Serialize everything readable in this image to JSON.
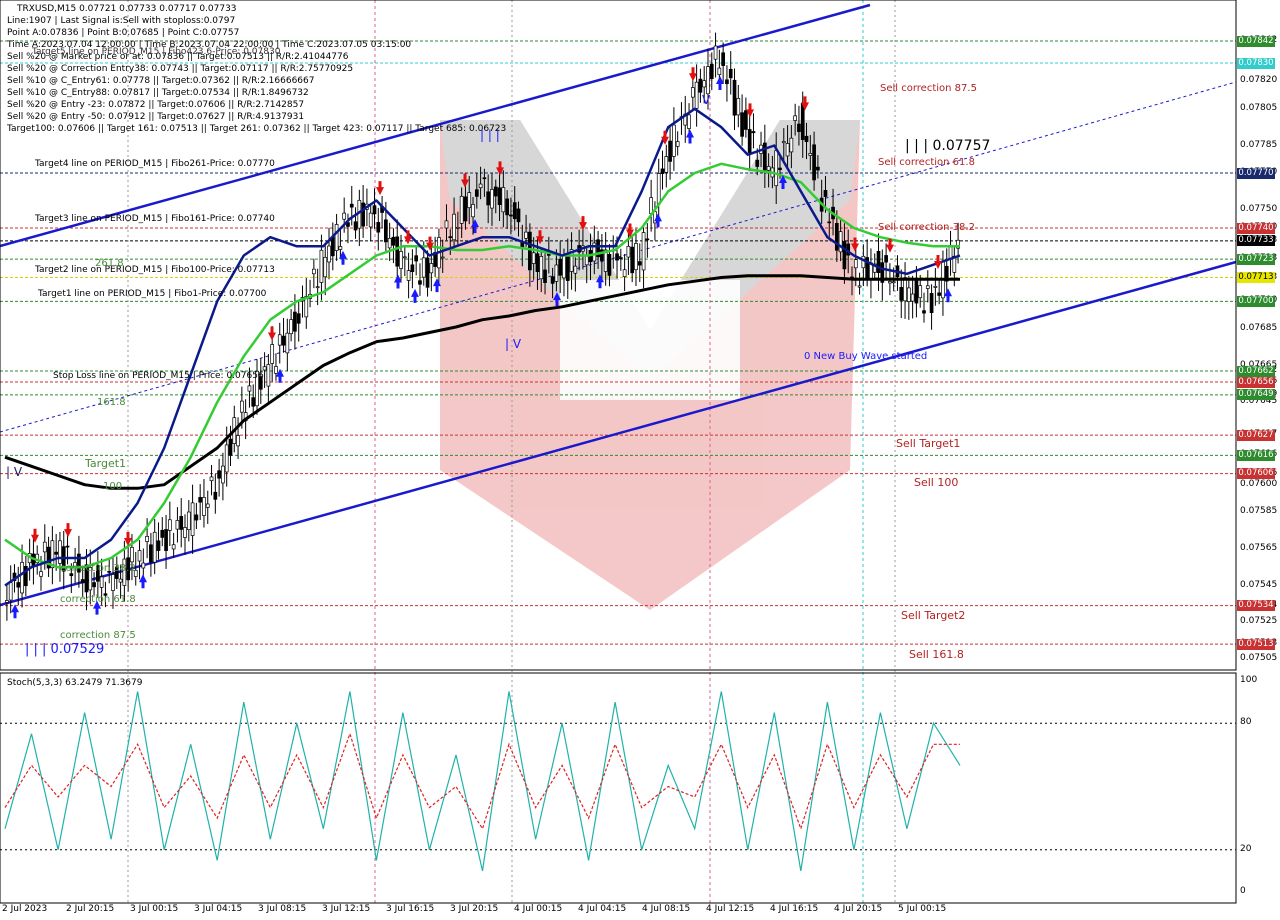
{
  "header": {
    "symbol_line": "TRXUSD,M15  0.07721 0.07733 0.07717 0.07733",
    "lines": [
      "Line:1907 | Last Signal is:Sell with stoploss:0.0797",
      "Point A:0.07836 | Point B:0.07685 | Point C:0.07757",
      "Time A:2023.07.04 12:00:00 | Time B:2023.07.04 22:00:00 | Time C:2023.07.05 03:15:00",
      "Sell %20 @ Market price or at: 0.07836 || Target:0.07513 || R/R:2.41044776",
      "Sell %20 @ Correction Entry38: 0.07743 || Target:0.07117 || R/R:2.75770925",
      "Sell %10 @ C_Entry61: 0.07778 || Target:0.07362 || R/R:2.16666667",
      "Sell %10 @ C_Entry88: 0.07817 || Target:0.07534 || R/R:1.8496732",
      "Sell %20 @ Entry -23: 0.07872 || Target:0.07606 || R/R:2.7142857",
      "Sell %20 @ Entry -50: 0.07912 || Target:0.07627 || R/R:4.9137931",
      "Target100: 0.07606 || Target 161: 0.07513 || Target 261: 0.07362 || Target 423: 0.07117 || Target 685: 0.06723"
    ],
    "overlay_line": "Target5 line on PERIOD_M15 | Fibo423.6-Price: 0.07830"
  },
  "chart_labels": {
    "target4": "Target4 line on PERIOD_M15 | Fibo261-Price: 0.07770",
    "target3": "Target3 line on PERIOD_M15 | Fibo161-Price: 0.07740",
    "target2": "Target2 line on PERIOD_M15 | Fibo100-Price: 0.07713",
    "target1_overlap": "Target1 line on PERIOD_M15 | Fibo1-Price: 0.07700",
    "stoploss": "Stop Loss line on PERIOD_M15 | Price: 0.07656",
    "fib_2618": "261.8",
    "fib_1618": "161.8",
    "target1_green": "Target1",
    "fib_100": "100",
    "corr_382": "correction 38.2",
    "corr_618": "correction 61.8",
    "corr_875": "correction 87.5",
    "wave_low": "| | | 0.07529",
    "wave_iv_left": "| V",
    "wave_iv_mid": "| V",
    "wave_iii": "| | |",
    "wave_v": "V",
    "wave_c": "| | | 0.07757",
    "sell_corr_875": "Sell correction 87.5",
    "sell_corr_618": "Sell correction 61.8",
    "sell_corr_382": "Sell correction 38.2",
    "buy_wave": "0 New Buy Wave started",
    "sell_target1": "Sell Target1",
    "sell_100": "Sell 100",
    "sell_target2": "Sell Target2",
    "sell_1618": "Sell 161.8"
  },
  "price_axis": {
    "ticks": [
      "0.07842",
      "0.07820",
      "0.07805",
      "0.07785",
      "0.07770",
      "0.07750",
      "0.07740",
      "0.07733",
      "0.07723",
      "0.07713",
      "0.07700",
      "0.07685",
      "0.07665",
      "0.07662",
      "0.07656",
      "0.07649",
      "0.07645",
      "0.07627",
      "0.07616",
      "0.07606",
      "0.07600",
      "0.07585",
      "0.07565",
      "0.07545",
      "0.07534",
      "0.07525",
      "0.07513",
      "0.07505"
    ]
  },
  "price_tags": [
    {
      "text": "0.07842",
      "color": "#2e8b2e",
      "price": 0.07842
    },
    {
      "text": "0.07830",
      "color": "#33cccc",
      "price": 0.0783
    },
    {
      "text": "0.07770",
      "color": "#1a2a6c",
      "price": 0.0777
    },
    {
      "text": "0.07740",
      "color": "#c83232",
      "price": 0.0774
    },
    {
      "text": "0.07733",
      "color": "#000000",
      "price": 0.07733
    },
    {
      "text": "0.07723",
      "color": "#2e8b2e",
      "price": 0.07723
    },
    {
      "text": "0.07713",
      "color": "#e6e600",
      "price": 0.07713
    },
    {
      "text": "0.07700",
      "color": "#2e8b2e",
      "price": 0.077
    },
    {
      "text": "0.07662",
      "color": "#2e8b2e",
      "price": 0.07662
    },
    {
      "text": "0.07656",
      "color": "#c83232",
      "price": 0.07656
    },
    {
      "text": "0.07649",
      "color": "#2e8b2e",
      "price": 0.07649
    },
    {
      "text": "0.07627",
      "color": "#c83232",
      "price": 0.07627
    },
    {
      "text": "0.07616",
      "color": "#2e8b2e",
      "price": 0.07616
    },
    {
      "text": "0.07606",
      "color": "#c83232",
      "price": 0.07606
    },
    {
      "text": "0.07534",
      "color": "#c83232",
      "price": 0.07534
    },
    {
      "text": "0.07513",
      "color": "#c83232",
      "price": 0.07513
    }
  ],
  "date_axis": [
    "2 Jul 2023",
    "2 Jul 20:15",
    "3 Jul 00:15",
    "3 Jul 04:15",
    "3 Jul 08:15",
    "3 Jul 12:15",
    "3 Jul 16:15",
    "3 Jul 20:15",
    "4 Jul 00:15",
    "4 Jul 04:15",
    "4 Jul 08:15",
    "4 Jul 12:15",
    "4 Jul 16:15",
    "4 Jul 20:15",
    "5 Jul 00:15"
  ],
  "oscillator": {
    "title": "Stoch(5,3,3) 63.2479 71.3679",
    "levels": [
      "100",
      "80",
      "20",
      "0"
    ]
  },
  "chart_data": {
    "type": "line",
    "title": "TRXUSD,M15",
    "ohlc_last": {
      "open": 0.07721,
      "high": 0.07733,
      "low": 0.07717,
      "close": 0.07733
    },
    "ylim": [
      0.075,
      0.0786
    ],
    "horizontal_levels": [
      {
        "name": "Target5",
        "price": 0.0783,
        "color": "#33cccc"
      },
      {
        "name": "Target4",
        "price": 0.0777,
        "color": "#1a2a6c"
      },
      {
        "name": "Target3",
        "price": 0.0774,
        "color": "#c83232"
      },
      {
        "name": "Target2",
        "price": 0.07713,
        "color": "#e6e600"
      },
      {
        "name": "Target1",
        "price": 0.077,
        "color": "#2e8b2e"
      },
      {
        "name": "Stop Loss",
        "price": 0.07656,
        "color": "#c83232"
      }
    ],
    "close_approx": [
      0.0754,
      0.07555,
      0.07565,
      0.0755,
      0.07545,
      0.0756,
      0.0757,
      0.0758,
      0.076,
      0.0764,
      0.07665,
      0.0769,
      0.0772,
      0.07745,
      0.0775,
      0.0772,
      0.07715,
      0.07745,
      0.0776,
      0.07755,
      0.0772,
      0.07715,
      0.0773,
      0.0772,
      0.07725,
      0.0778,
      0.0781,
      0.07835,
      0.0779,
      0.0777,
      0.078,
      0.0775,
      0.07715,
      0.0772,
      0.07705,
      0.077,
      0.07733
    ],
    "ma_blue": [
      0.07545,
      0.07555,
      0.0756,
      0.0756,
      0.0757,
      0.0759,
      0.0762,
      0.0766,
      0.077,
      0.07725,
      0.07735,
      0.0773,
      0.0773,
      0.07745,
      0.07755,
      0.0774,
      0.07725,
      0.0773,
      0.07735,
      0.07735,
      0.0773,
      0.07725,
      0.0773,
      0.0773,
      0.0776,
      0.07795,
      0.07805,
      0.07795,
      0.0778,
      0.07785,
      0.0776,
      0.07735,
      0.07725,
      0.07718,
      0.07715,
      0.0772,
      0.07725
    ],
    "ma_green": [
      0.0757,
      0.0756,
      0.07555,
      0.07555,
      0.0756,
      0.0757,
      0.0759,
      0.07615,
      0.07645,
      0.0767,
      0.0769,
      0.077,
      0.07705,
      0.07715,
      0.07725,
      0.0773,
      0.0773,
      0.07728,
      0.07728,
      0.0773,
      0.07728,
      0.07725,
      0.07725,
      0.07728,
      0.0774,
      0.0776,
      0.0777,
      0.07775,
      0.07772,
      0.0777,
      0.07765,
      0.0775,
      0.0774,
      0.07735,
      0.07732,
      0.0773,
      0.0773
    ],
    "ma_black": [
      0.07615,
      0.0761,
      0.07605,
      0.076,
      0.07598,
      0.07598,
      0.076,
      0.0761,
      0.0762,
      0.07635,
      0.07645,
      0.07655,
      0.07665,
      0.07672,
      0.07678,
      0.0768,
      0.07683,
      0.07686,
      0.0769,
      0.07692,
      0.07695,
      0.07697,
      0.077,
      0.07703,
      0.07706,
      0.07709,
      0.07711,
      0.07713,
      0.07714,
      0.07714,
      0.07714,
      0.07713,
      0.07712,
      0.07712,
      0.07712,
      0.07712,
      0.07712
    ],
    "stoch_k": [
      30,
      75,
      20,
      85,
      25,
      95,
      20,
      70,
      15,
      90,
      25,
      80,
      30,
      95,
      15,
      85,
      20,
      65,
      10,
      95,
      25,
      80,
      15,
      90,
      20,
      60,
      30,
      95,
      20,
      85,
      10,
      90,
      20,
      85,
      30,
      80,
      60
    ],
    "stoch_d": [
      40,
      60,
      45,
      60,
      50,
      70,
      40,
      55,
      35,
      65,
      40,
      65,
      40,
      75,
      35,
      65,
      40,
      50,
      30,
      70,
      40,
      60,
      35,
      70,
      40,
      50,
      45,
      70,
      40,
      65,
      30,
      70,
      40,
      65,
      45,
      70,
      70
    ]
  }
}
